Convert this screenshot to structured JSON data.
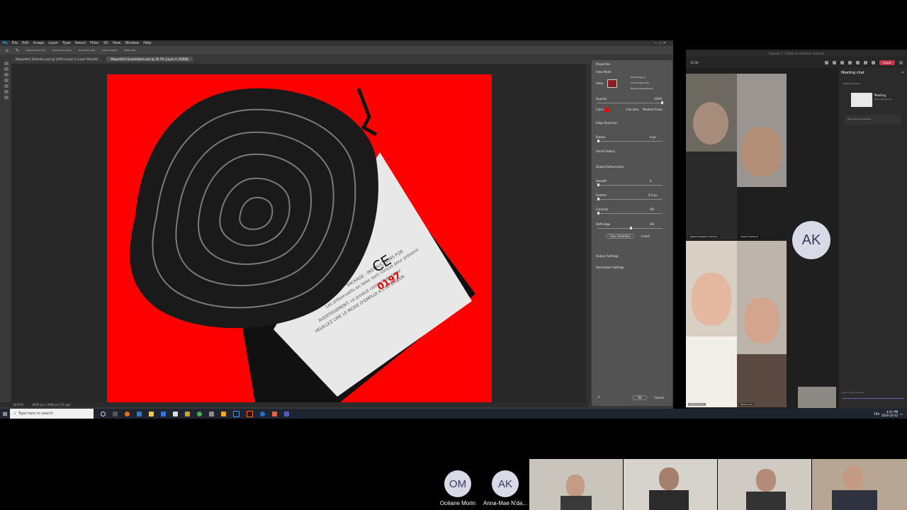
{
  "photoshop": {
    "menu": [
      "File",
      "Edit",
      "Image",
      "Layer",
      "Type",
      "Select",
      "Filter",
      "3D",
      "View",
      "Window",
      "Help"
    ],
    "options": [
      "Refine Radius Tool",
      "Sample All Layers",
      "Decontaminate",
      "Select Subject",
      "Refine Hair"
    ],
    "tabs": [
      {
        "label": "Maquette1 Selection.psd @ 100% (Layer 0, Layer Mask/8)"
      },
      {
        "label": "Maquette2 Quadrilatere.psd @ 16.7% (Layer 0, RGB/8)"
      }
    ],
    "status": [
      "16.67%",
      "4000 px x 3000 px (72 ppi)"
    ],
    "properties": {
      "title": "Properties",
      "view_mode": "View Mode",
      "show_edge": "Show Edge (J)",
      "show_original": "Show Original (P)",
      "high_quality": "High Quality Preview",
      "view": "View:",
      "opacity": "Opacity",
      "opacity_value": "100%",
      "color": "Color:",
      "indicates": "Indicates:",
      "masked_areas": "Masked Areas",
      "edge_detection": "Edge Detection",
      "radius": "Radius",
      "radius_value": "0 px",
      "smart_radius": "Smart Radius",
      "global_refinements": "Global Refinements",
      "smooth": "Smooth",
      "smooth_value": "0",
      "feather": "Feather",
      "feather_value": "0.0 px",
      "contrast": "Contrast",
      "contrast_value": "0%",
      "shift_edge": "Shift Edge",
      "shift_edge_value": "0%",
      "clear_selection": "Clear Selection",
      "invert": "Invert",
      "output_settings": "Output Settings",
      "remember_settings": "Remember Settings",
      "ok": "OK",
      "cancel": "Cancel"
    }
  },
  "taskbar": {
    "search_placeholder": "Type here to search",
    "time": "4:41 PM",
    "date": "2020-10-22",
    "lang": "FRA"
  },
  "teams": {
    "window_title": "Capsule 3 - Outils de sélection avancés",
    "timer": "35:06",
    "leave": "Leave",
    "chat_title": "Meeting chat",
    "chat_meeting": "Meeting",
    "chat_recorded": "Recorded by: Jer...",
    "chat_started": "Meeting started",
    "chat_recording": "Recording has started",
    "chat_input_placeholder": "Type a new message",
    "participants": [
      {
        "name": "Catherine Bizzarri-Hermier"
      },
      {
        "name": "Albert Chiarbous"
      },
      {
        "name": "Océane Morin"
      },
      {
        "name": "Tamara Fog"
      }
    ],
    "avatar_ak": "AK"
  },
  "strip": {
    "tiles": [
      {
        "initials": "OM",
        "name": "Océane Morin"
      },
      {
        "initials": "AK",
        "name": "Anna-Mae N'da..."
      }
    ]
  },
  "colors": {
    "canvas_red": "#ff0000",
    "ps_bg": "#383838",
    "teams_leave": "#c4314b",
    "avatar_bg": "#d9d9e8"
  }
}
